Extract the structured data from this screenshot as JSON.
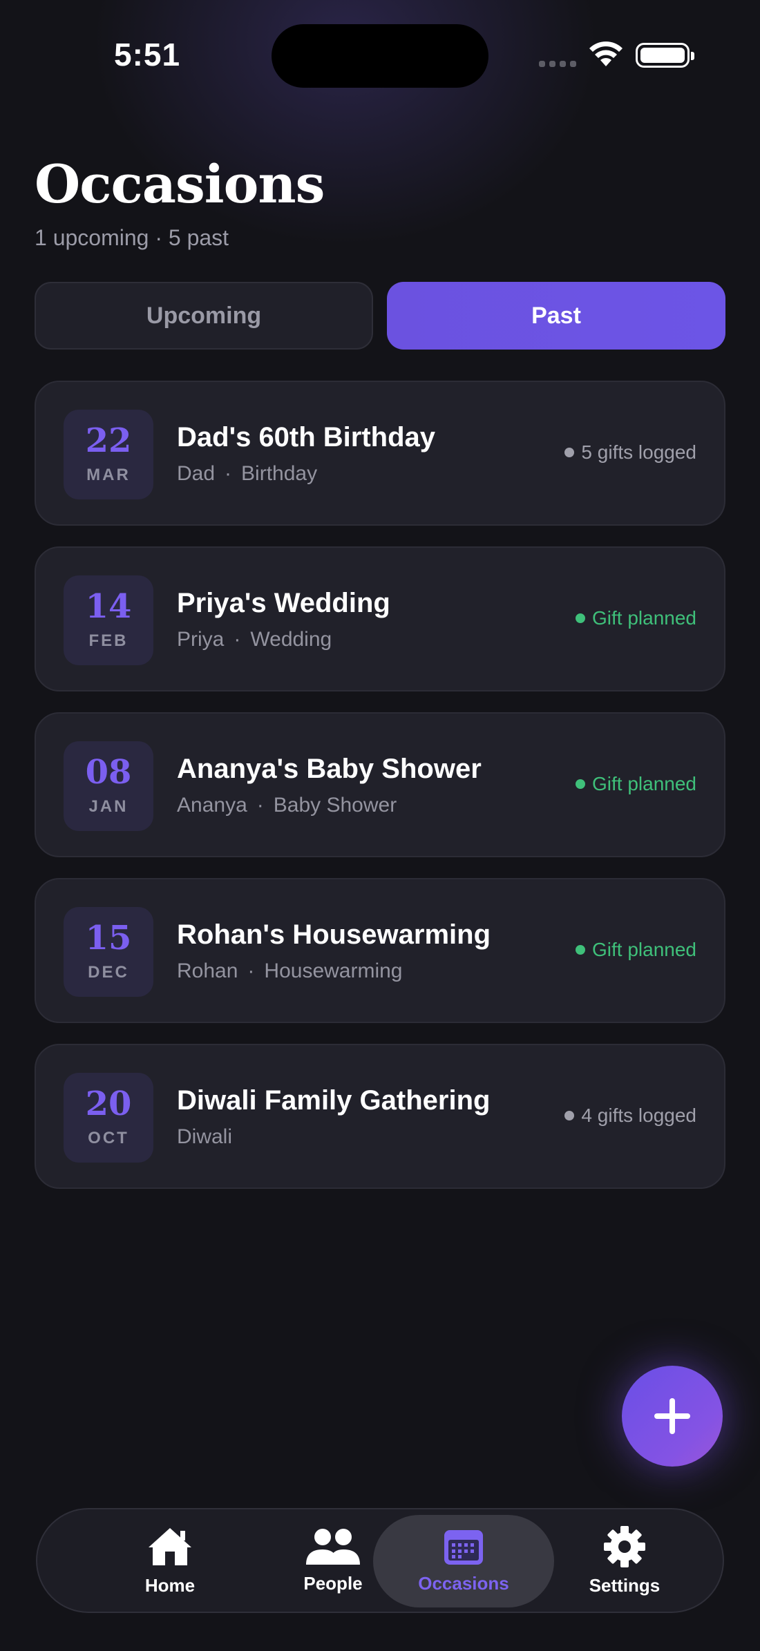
{
  "status_bar": {
    "time": "5:51"
  },
  "header": {
    "title": "Occasions",
    "subtitle": "1 upcoming · 5 past"
  },
  "tabs": [
    {
      "label": "Upcoming",
      "selected": false
    },
    {
      "label": "Past",
      "selected": true
    }
  ],
  "occasions": [
    {
      "day": "22",
      "month": "MAR",
      "title": "Dad's 60th Birthday",
      "person": "Dad",
      "type": "Birthday",
      "status": "5 gifts logged",
      "status_kind": "logged"
    },
    {
      "day": "14",
      "month": "FEB",
      "title": "Priya's Wedding",
      "person": "Priya",
      "type": "Wedding",
      "status": "Gift planned",
      "status_kind": "planned"
    },
    {
      "day": "08",
      "month": "JAN",
      "title": "Ananya's Baby Shower",
      "person": "Ananya",
      "type": "Baby Shower",
      "status": "Gift planned",
      "status_kind": "planned"
    },
    {
      "day": "15",
      "month": "DEC",
      "title": "Rohan's Housewarming",
      "person": "Rohan",
      "type": "Housewarming",
      "status": "Gift planned",
      "status_kind": "planned"
    },
    {
      "day": "20",
      "month": "OCT",
      "title": "Diwali Family Gathering",
      "person": "Diwali",
      "type": "",
      "status": "4 gifts logged",
      "status_kind": "logged"
    }
  ],
  "fab": {
    "icon": "plus-icon"
  },
  "nav": {
    "items": [
      {
        "label": "Home",
        "icon": "home-icon"
      },
      {
        "label": "People",
        "icon": "people-icon"
      },
      {
        "label": "Occasions",
        "icon": "calendar-icon",
        "active": true
      },
      {
        "label": "Settings",
        "icon": "gear-icon"
      }
    ]
  },
  "colors": {
    "background": "#131318",
    "accent": "#6b52e0",
    "card": "#21212a",
    "status_green": "#3fc07a",
    "status_grey": "#a0a0ab"
  }
}
